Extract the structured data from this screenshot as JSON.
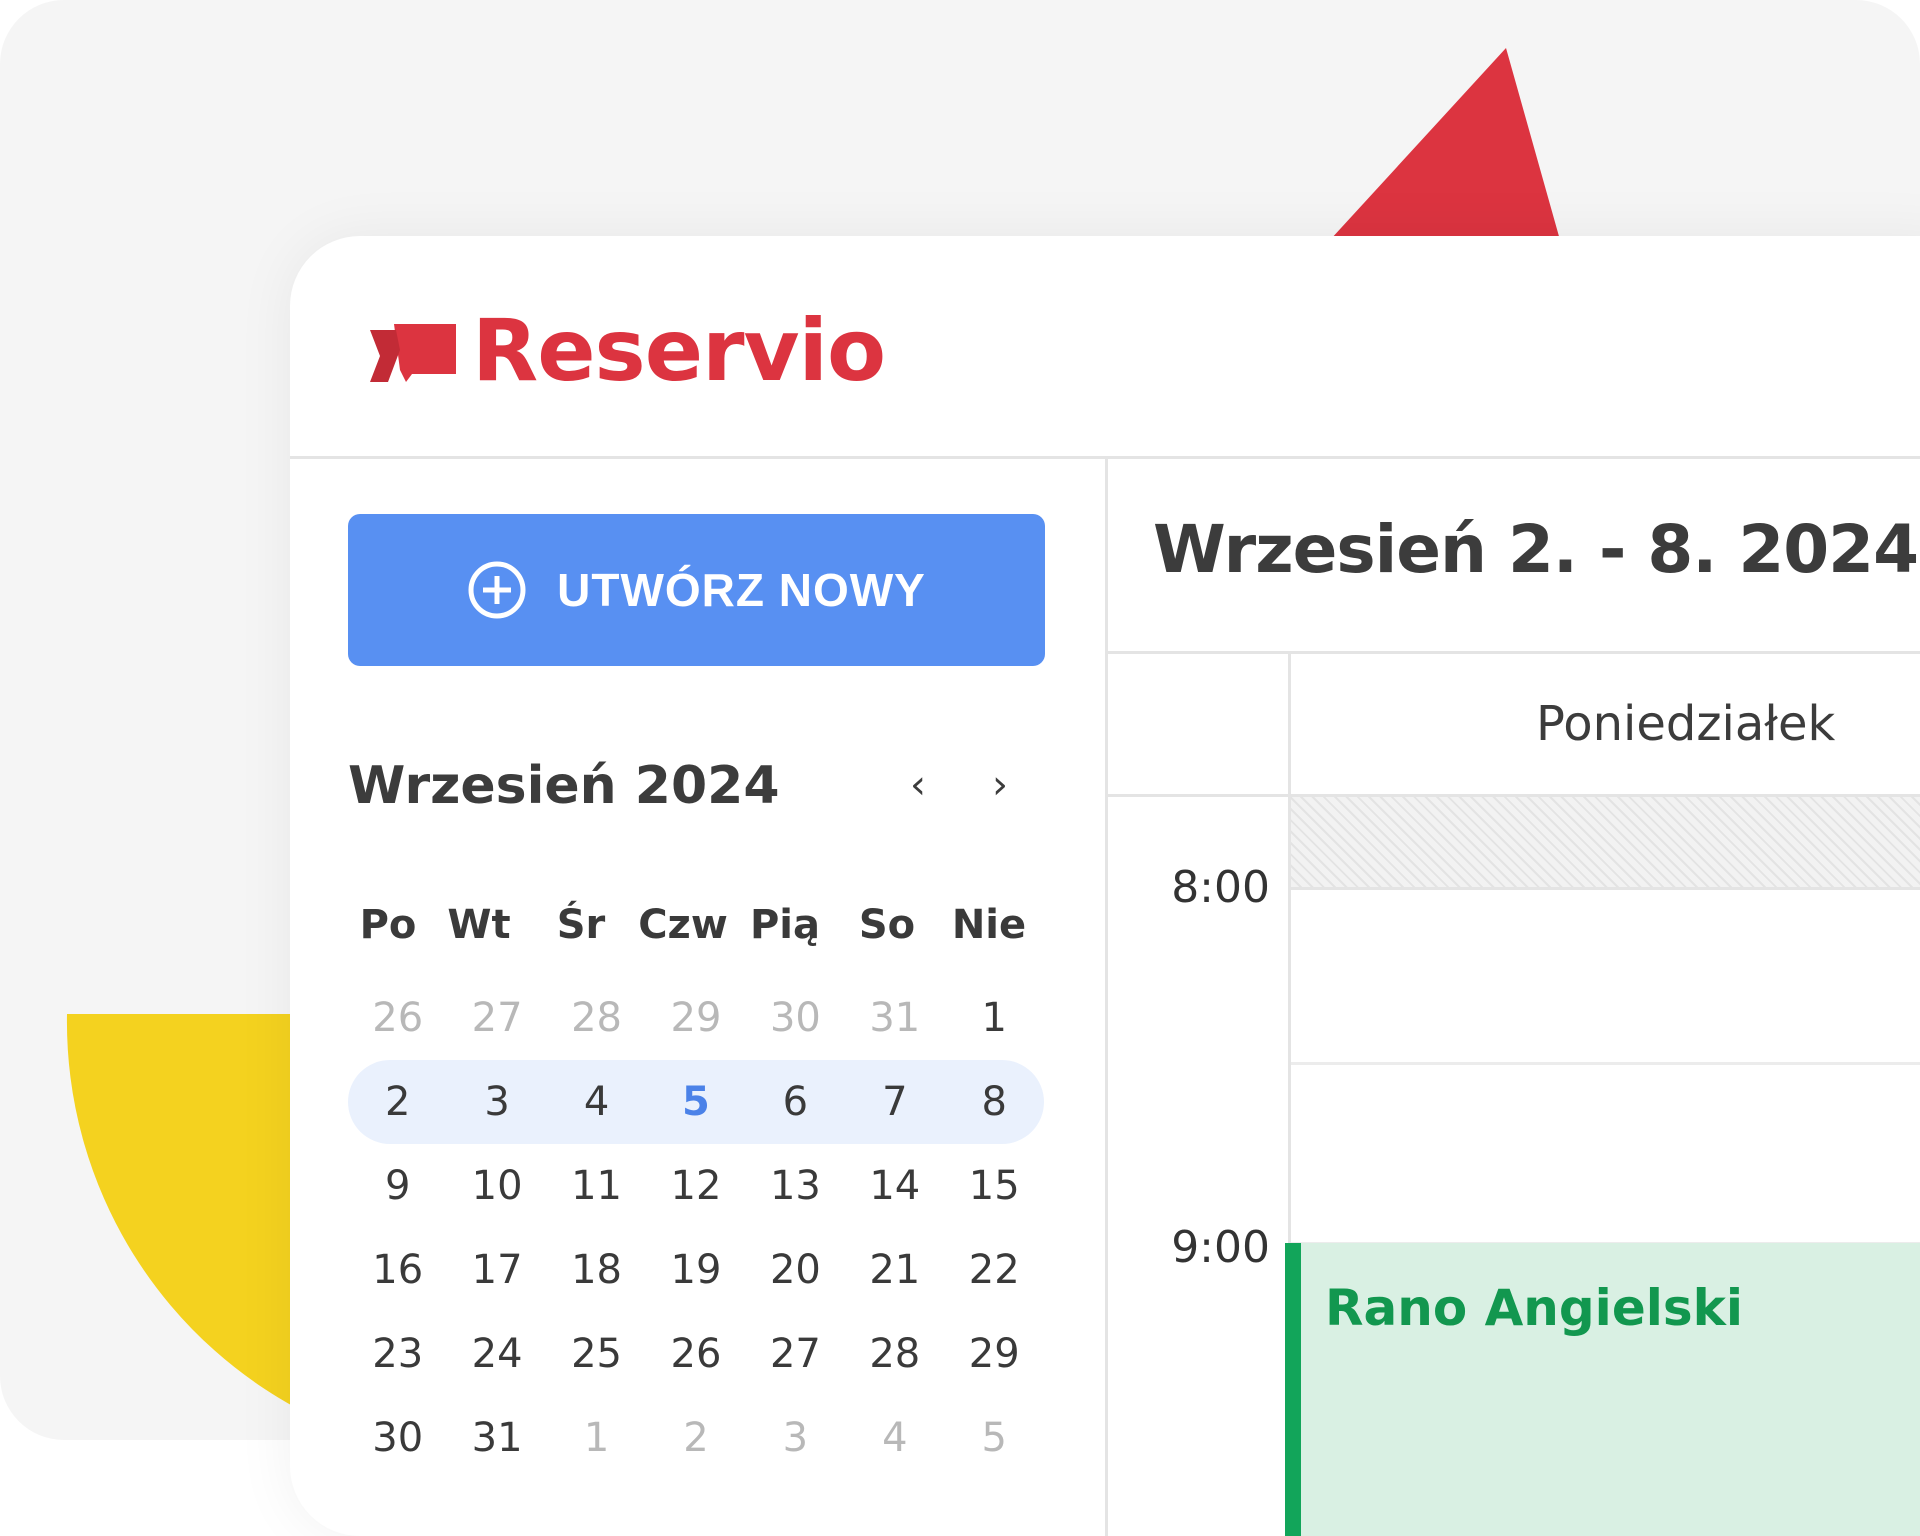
{
  "brand": {
    "name": "Reservio",
    "color": "#dc3440"
  },
  "create_button": {
    "label": "UTWÓRZ NOWY",
    "icon": "plus-circle-icon"
  },
  "mini_calendar": {
    "title": "Wrzesień 2024",
    "prev_icon": "chevron-left-icon",
    "next_icon": "chevron-right-icon",
    "weekdays": [
      "Po",
      "Wt",
      "Śr",
      "Czw",
      "Pią",
      "So",
      "Nie"
    ],
    "weeks": [
      [
        "26",
        "27",
        "28",
        "29",
        "30",
        "31",
        "1"
      ],
      [
        "2",
        "3",
        "4",
        "5",
        "6",
        "7",
        "8"
      ],
      [
        "9",
        "10",
        "11",
        "12",
        "13",
        "14",
        "15"
      ],
      [
        "16",
        "17",
        "18",
        "19",
        "20",
        "21",
        "22"
      ],
      [
        "23",
        "24",
        "25",
        "26",
        "27",
        "28",
        "29"
      ],
      [
        "30",
        "31",
        "1",
        "2",
        "3",
        "4",
        "5"
      ]
    ],
    "today": "5"
  },
  "week_view": {
    "range_title": "Wrzesień 2. - 8. 2024",
    "day_name": "Poniedziałek",
    "times": [
      "8:00",
      "9:00"
    ]
  },
  "event": {
    "title": "Rano Angielski",
    "color": "#12a55a"
  }
}
